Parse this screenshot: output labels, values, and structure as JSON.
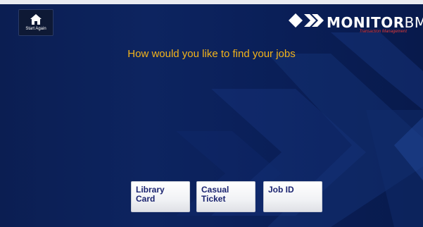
{
  "header": {
    "home_button": {
      "label": "Start Again",
      "icon": "home-icon"
    },
    "logo": {
      "brand_main": "MONITOR",
      "brand_suffix": "BM",
      "tagline": "Transaction Management"
    }
  },
  "main": {
    "prompt": "How would you like to find your jobs",
    "options": [
      {
        "label": "Library Card"
      },
      {
        "label": "Casual Ticket"
      },
      {
        "label": "Job ID"
      }
    ]
  },
  "colors": {
    "background": "#0b1e52",
    "prompt_text": "#f4b41a",
    "button_text": "#1b2470",
    "logo_accent": "#e03838"
  }
}
